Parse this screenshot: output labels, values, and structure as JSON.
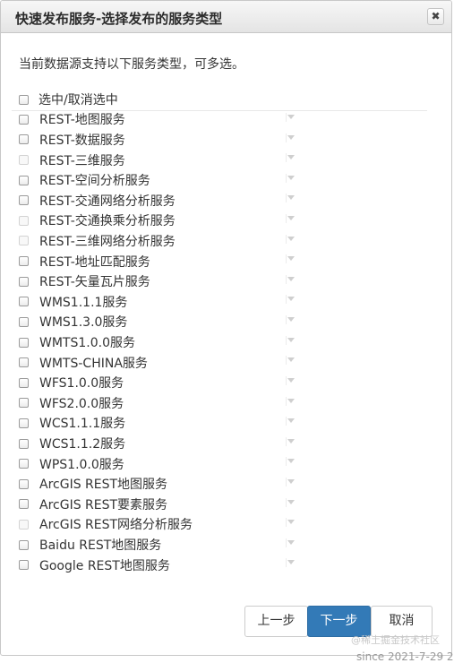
{
  "dialog": {
    "title": "快速发布服务-选择发布的服务类型",
    "close_glyph": "✖",
    "description": "当前数据源支持以下服务类型，可多选。"
  },
  "select_all": {
    "label": "选中/取消选中",
    "checked": false
  },
  "services": [
    {
      "label": "REST-地图服务",
      "enabled": true,
      "checked": false
    },
    {
      "label": "REST-数据服务",
      "enabled": true,
      "checked": false
    },
    {
      "label": "REST-三维服务",
      "enabled": false,
      "checked": false
    },
    {
      "label": "REST-空间分析服务",
      "enabled": true,
      "checked": false
    },
    {
      "label": "REST-交通网络分析服务",
      "enabled": true,
      "checked": false
    },
    {
      "label": "REST-交通换乘分析服务",
      "enabled": false,
      "checked": false
    },
    {
      "label": "REST-三维网络分析服务",
      "enabled": false,
      "checked": false
    },
    {
      "label": "REST-地址匹配服务",
      "enabled": true,
      "checked": false
    },
    {
      "label": "REST-矢量瓦片服务",
      "enabled": true,
      "checked": false
    },
    {
      "label": "WMS1.1.1服务",
      "enabled": true,
      "checked": false
    },
    {
      "label": "WMS1.3.0服务",
      "enabled": true,
      "checked": false
    },
    {
      "label": "WMTS1.0.0服务",
      "enabled": true,
      "checked": false
    },
    {
      "label": "WMTS-CHINA服务",
      "enabled": true,
      "checked": false
    },
    {
      "label": "WFS1.0.0服务",
      "enabled": true,
      "checked": false
    },
    {
      "label": "WFS2.0.0服务",
      "enabled": true,
      "checked": false
    },
    {
      "label": "WCS1.1.1服务",
      "enabled": true,
      "checked": false
    },
    {
      "label": "WCS1.1.2服务",
      "enabled": true,
      "checked": false
    },
    {
      "label": "WPS1.0.0服务",
      "enabled": true,
      "checked": false
    },
    {
      "label": "ArcGIS REST地图服务",
      "enabled": true,
      "checked": false
    },
    {
      "label": "ArcGIS REST要素服务",
      "enabled": true,
      "checked": false
    },
    {
      "label": "ArcGIS REST网络分析服务",
      "enabled": false,
      "checked": false
    },
    {
      "label": "Baidu REST地图服务",
      "enabled": true,
      "checked": false
    },
    {
      "label": "Google REST地图服务",
      "enabled": true,
      "checked": false
    }
  ],
  "buttons": {
    "prev_label": "上一步",
    "next_label": "下一步",
    "cancel_label": "取消"
  },
  "watermark": "@稀土掘金技术社区",
  "footer": "since 2021-7-29 2"
}
